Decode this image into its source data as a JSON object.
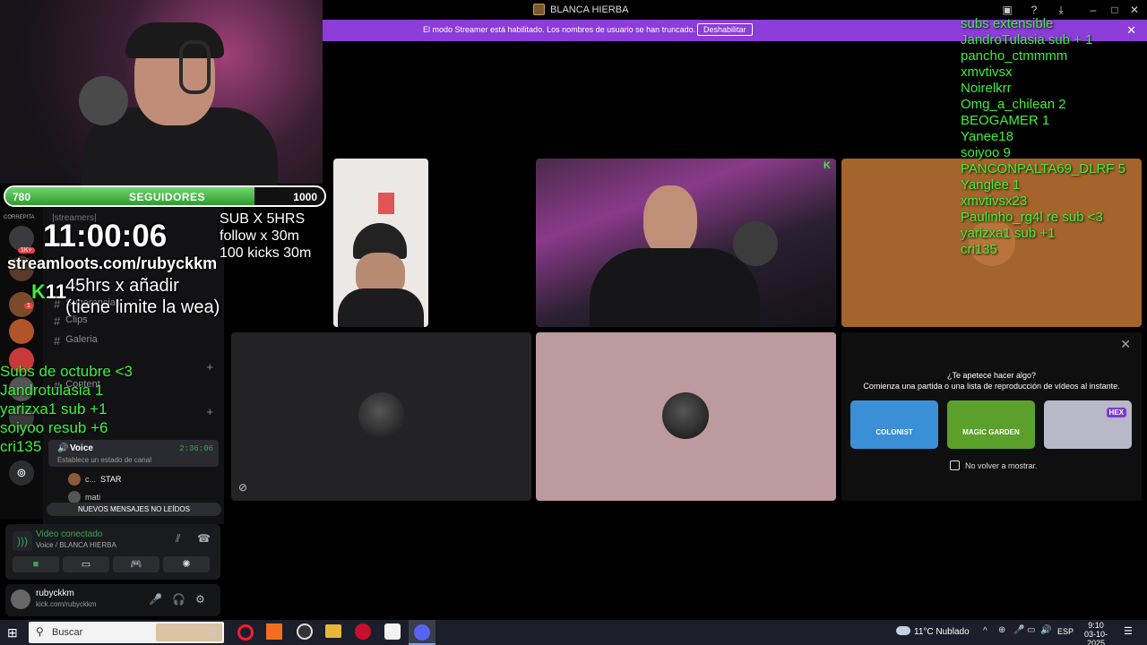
{
  "window": {
    "title": "BLANCA HIERBA"
  },
  "streamer_banner": {
    "text": "El modo Streamer está habilitado. Los nombres de usuario se han truncado.",
    "button": "Deshabilitar",
    "close": "✕"
  },
  "channels": {
    "category": "|streamers|",
    "items": [
      {
        "name": "Sugerencias"
      },
      {
        "name": "Clips"
      },
      {
        "name": "Galeria"
      },
      {
        "name": "Content"
      }
    ],
    "voice": {
      "name": "Voice",
      "timer": "2:36:06",
      "status": "Establece un estado de canal"
    },
    "voice_users": [
      {
        "name": "c...",
        "badge": "STAR"
      },
      {
        "name": "mati"
      }
    ],
    "unread_banner": "NUEVOS MENSAJES NO LEÍDOS"
  },
  "guild_badges": {
    "top_label": "CORREPITA",
    "count": "1K+",
    "mention": "1"
  },
  "voice_panel": {
    "status": "Video conectado",
    "channel": "Voice / BLANCA HIERBA"
  },
  "user_panel": {
    "username": "rubyckkm",
    "status": "kick.com/rubyckkm"
  },
  "activity": {
    "question": "¿Te apetece hacer algo?",
    "subtitle": "Comienza una partida o una lista de reproducción de vídeos al instante.",
    "games": [
      {
        "name": "COLONIST",
        "color": "#3a8fd6"
      },
      {
        "name": "MAGIC GARDEN",
        "color": "#5aa02a"
      },
      {
        "name": "HEX",
        "color": "#b8b8c8"
      }
    ],
    "checkbox_label": "No volver a mostrar."
  },
  "overlay": {
    "follow_goal": {
      "current": "780",
      "label": "SEGUIDORES",
      "target": "1000",
      "progress": 0.78
    },
    "timer": "11:00:06",
    "rules": [
      "SUB X 5HRS",
      "follow x 30m",
      "100 kicks 30m"
    ],
    "streamloots": "streamloots.com/rubyckkm",
    "hours_count": "11",
    "hours_text": [
      "45hrs  x añadir",
      "(tiene limite la wea)"
    ],
    "subs_october": [
      "Subs de octubre <3",
      "Jandrotulasia 1",
      "yarizxa1 sub +1",
      "soiyoo resub +6",
      "cri135"
    ],
    "subs_extensible": [
      "subs extensible",
      "JandroTulasia sub + 1",
      "pancho_ctmmmm",
      "xmvtivsx",
      "Noirelkrr",
      "Omg_a_chilean 2",
      "BEOGAMER 1",
      "Yanee18",
      "soiyoo 9",
      "PANCONPALTA69_DLRF 5",
      "Yanglee 1",
      "xmvtivsx23",
      "Paulinho_rg4l  re sub <3",
      "yarizxa1 sub +1",
      "cri135"
    ]
  },
  "taskbar": {
    "search_placeholder": "Buscar",
    "weather": "11°C  Nublado",
    "lang": "ESP",
    "time": "9:10",
    "date": "03-10-2025"
  }
}
